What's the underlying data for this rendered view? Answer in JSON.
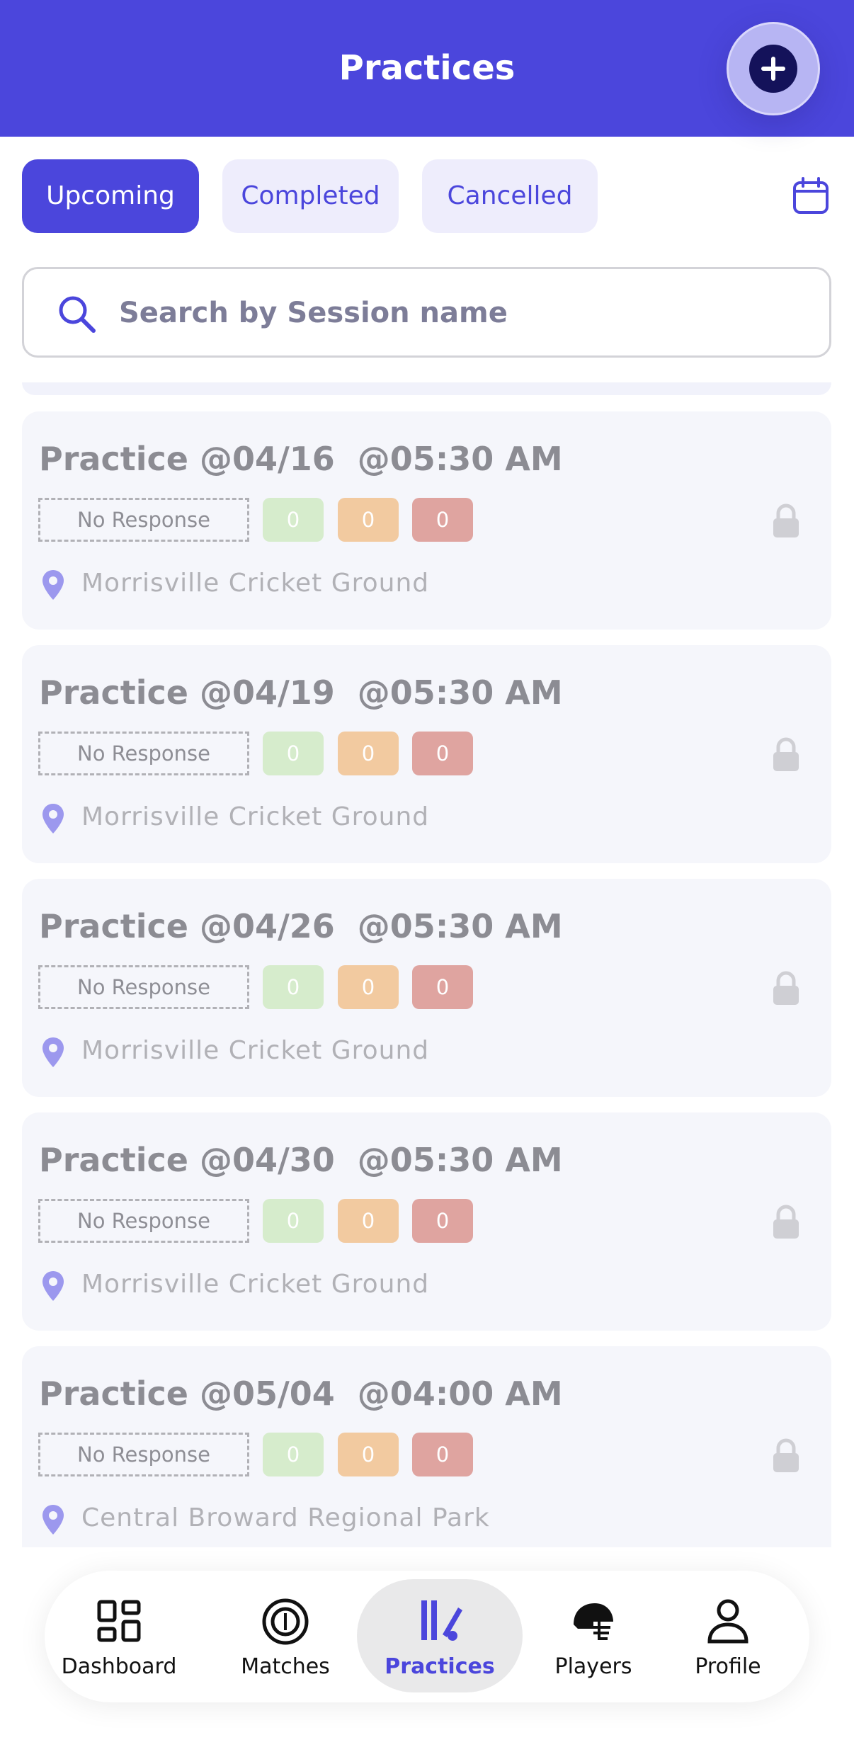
{
  "header": {
    "title": "Practices"
  },
  "tabs": [
    {
      "label": "Upcoming",
      "active": true
    },
    {
      "label": "Completed",
      "active": false
    },
    {
      "label": "Cancelled",
      "active": false
    }
  ],
  "search": {
    "placeholder": "Search by Session name"
  },
  "practices": [
    {
      "title": "Practice @04/16  @05:30 AM",
      "status": "No Response",
      "yes_count": "0",
      "maybe_count": "0",
      "no_count": "0",
      "location": "Morrisville Cricket Ground"
    },
    {
      "title": "Practice @04/19  @05:30 AM",
      "status": "No Response",
      "yes_count": "0",
      "maybe_count": "0",
      "no_count": "0",
      "location": "Morrisville Cricket Ground"
    },
    {
      "title": "Practice @04/26  @05:30 AM",
      "status": "No Response",
      "yes_count": "0",
      "maybe_count": "0",
      "no_count": "0",
      "location": "Morrisville Cricket Ground"
    },
    {
      "title": "Practice @04/30  @05:30 AM",
      "status": "No Response",
      "yes_count": "0",
      "maybe_count": "0",
      "no_count": "0",
      "location": "Morrisville Cricket Ground"
    },
    {
      "title": "Practice @05/04  @04:00 AM",
      "status": "No Response",
      "yes_count": "0",
      "maybe_count": "0",
      "no_count": "0",
      "location": "Central Broward Regional Park"
    }
  ],
  "nav": [
    {
      "label": "Dashboard",
      "icon": "dashboard-icon"
    },
    {
      "label": "Matches",
      "icon": "ball-icon"
    },
    {
      "label": "Practices",
      "icon": "cricket-bat-icon",
      "active": true
    },
    {
      "label": "Players",
      "icon": "helmet-icon"
    },
    {
      "label": "Profile",
      "icon": "person-icon"
    }
  ],
  "colors": {
    "primary": "#4b46dc",
    "yes": "#d6eccc",
    "maybe": "#f2caa0",
    "no": "#dfa4a0"
  }
}
